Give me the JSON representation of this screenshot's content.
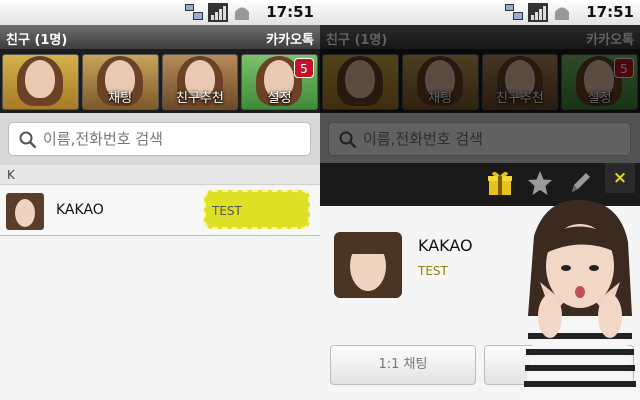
{
  "status_bar": {
    "time": "17:51",
    "icons": [
      "network-icon",
      "signal-icon",
      "android-icon"
    ]
  },
  "header": {
    "title": "친구 (1명)",
    "app_name": "카카오톡"
  },
  "tabs": [
    {
      "label": "",
      "icon": "friends-tab-art"
    },
    {
      "label": "채팅",
      "icon": "chat-tab-art"
    },
    {
      "label": "친구추천",
      "icon": "recommend-tab-art"
    },
    {
      "label": "설정",
      "icon": "settings-tab-art",
      "badge": "5"
    }
  ],
  "search": {
    "placeholder": "이름,전화번호 검색"
  },
  "friends": {
    "section_header": "K",
    "items": [
      {
        "name": "KAKAO",
        "status": "TEST"
      }
    ]
  },
  "profile_popup": {
    "actions": [
      "gift-icon",
      "star-icon",
      "pencil-icon"
    ],
    "close_label": "×",
    "name": "KAKAO",
    "status": "TEST",
    "chat_button_label": "1:1 채팅",
    "second_button_label": ""
  },
  "colors": {
    "status_bubble": "#dde024",
    "badge": "#c3132a",
    "close_x": "#e8d41a"
  }
}
